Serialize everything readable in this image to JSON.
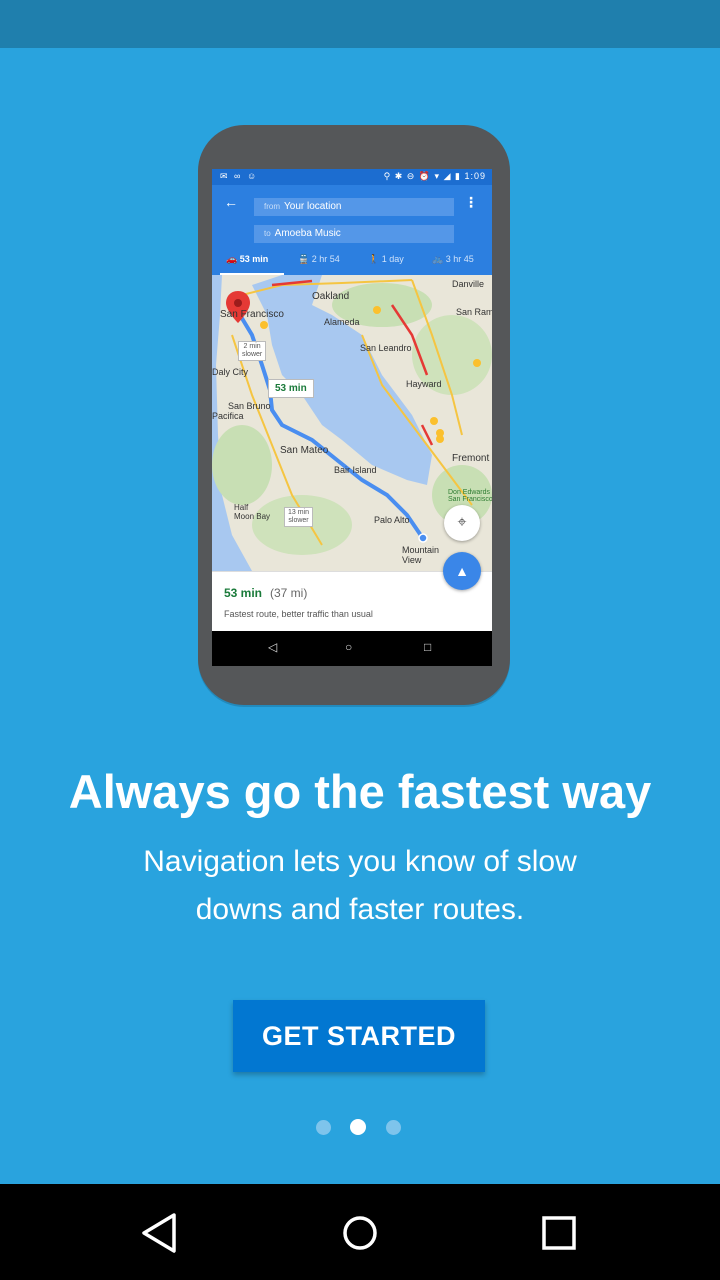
{
  "phone": {
    "status_icons_left": "✉ ∞ ☺",
    "status_icons_right": "⚲ ✱ ⊖ ⏰ ▾ ◢ ▮",
    "clock": "1:09",
    "from_prefix": "from",
    "from_value": "Your location",
    "to_prefix": "to",
    "to_value": "Amoeba Music",
    "modes": [
      {
        "icon": "🚗",
        "label": "53 min"
      },
      {
        "icon": "🚆",
        "label": "2 hr 54"
      },
      {
        "icon": "🚶",
        "label": "1 day"
      },
      {
        "icon": "🚲",
        "label": "3 hr 45"
      }
    ],
    "map_labels": {
      "oakland": "Oakland",
      "san_francisco": "San Francisco",
      "alameda": "Alameda",
      "danville": "Danville",
      "san_ramon": "San Ramon",
      "san_leandro": "San Leandro",
      "daly_city": "Daly City",
      "hayward": "Hayward",
      "san_bruno": "San Bruno",
      "pacifica": "Pacifica",
      "san_mateo": "San Mateo",
      "bair_island": "Bair Island",
      "fremont": "Fremont",
      "half_moon_bay": "Half\nMoon Bay",
      "don_edwards": "Don Edwards\nSan Francisco",
      "palo_alto": "Palo Alto",
      "mountain_view": "Mountain\nView"
    },
    "traffic_tag_1": "2 min\nslower",
    "traffic_tag_2": "13 min\nslower",
    "route_tag": "53 min",
    "summary_time": "53 min",
    "summary_distance": "(37 mi)",
    "summary_desc": "Fastest route, better traffic than usual"
  },
  "headline": "Always go the fastest way",
  "subtext": "Navigation lets you know of slow downs and faster routes.",
  "cta_label": "GET STARTED",
  "pagination": {
    "count": 3,
    "active_index": 1
  },
  "colors": {
    "background": "#29a3de",
    "status_bar": "#1f7fad",
    "button": "#0277d1",
    "route": "#4a8ef0",
    "maps_header": "#2c7fe0"
  }
}
